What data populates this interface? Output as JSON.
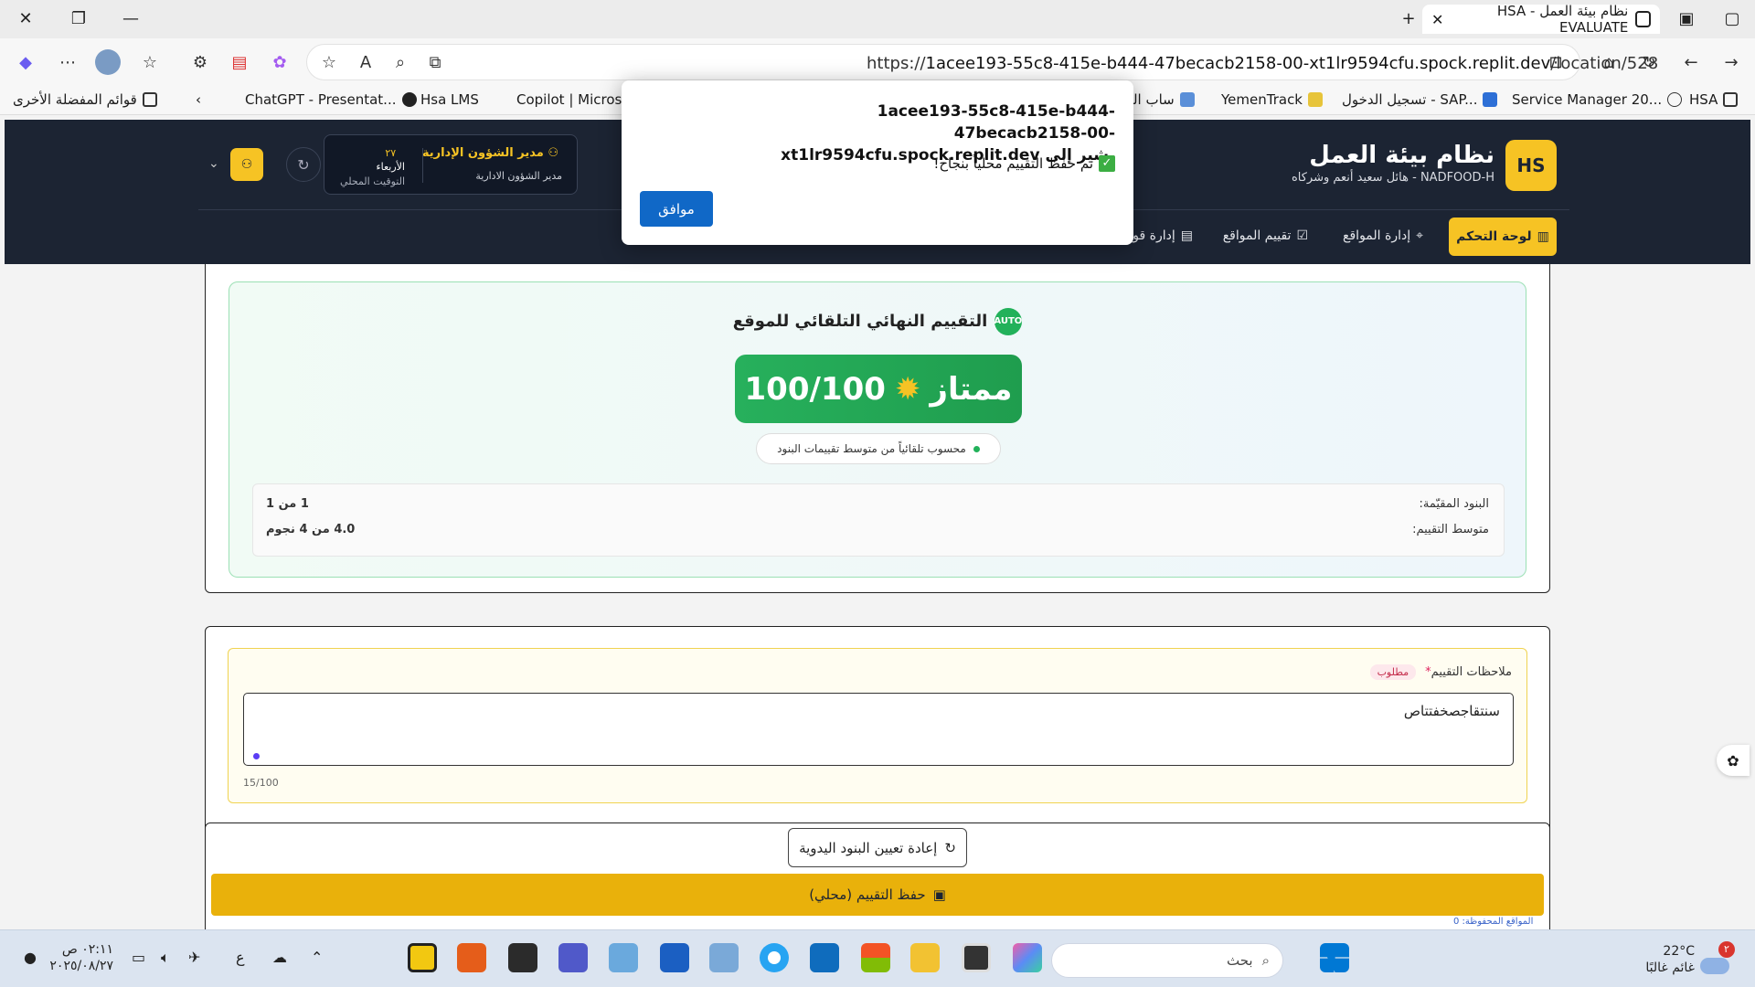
{
  "browser": {
    "tab_title": "نظام بيئة العمل - HSA EVALUATE",
    "url_prefix": "https://",
    "url_host": "1acee193-55c8-415e-b444-47becacb2158-00-xt1lr9594cfu.spock.replit.dev",
    "url_path": "/location/528"
  },
  "favorites": {
    "other": "قوائم المفضلة الأخرى",
    "items": [
      "ChatGPT - Presentat...",
      "Hsa LMS",
      "Copilot | Microsof",
      "ساب الم",
      "YemenTrack",
      "تسجيل الدخول - SAP...",
      "Service Manager 20...",
      "HSA"
    ]
  },
  "app": {
    "logo": "HS",
    "title": "نظام بيئة العمل",
    "subtitle": "NADFOOD-H - هائل سعيد أنعم وشركاه",
    "user_name": "مدير الشؤون الإدارية",
    "user_role": "مدير الشؤون الادارية",
    "day_num": "٢٧",
    "day_name": "الأربعاء",
    "timezone": "التوقيت المحلي",
    "nav": [
      "لوحة التحكم",
      "إدارة المواقع",
      "تقييم المواقع",
      "إدارة قوائم"
    ]
  },
  "dialog": {
    "host_line1": "1acee193-55c8-415e-b444-47becacb2158-00-",
    "host_line2": "xt1lr9594cfu.spock.replit.dev يشير إلى",
    "message": "تم حفظ التقييم محلياً بنجاح!",
    "ok": "موافق"
  },
  "final": {
    "badge": "AUTO",
    "title": "التقييم النهائي التلقائي للموقع",
    "score": "100/100",
    "grade": "ممتاز",
    "pill": "محسوب تلقائياً من متوسط تقييمات البنود",
    "stats": [
      {
        "label": "البنود المقيّمة:",
        "value": "1 من 1"
      },
      {
        "label": "متوسط التقييم:",
        "value": "4.0 من 4 نجوم"
      }
    ]
  },
  "notes": {
    "label": "ملاحظات التقييم",
    "asterisk": "*",
    "required": "مطلوب",
    "value": "سنتقاجصخفتتاص",
    "counter": "15/100"
  },
  "actions": {
    "reset": "إعادة تعيين البنود اليدوية",
    "save": "حفظ التقييم (محلي)",
    "footnote": "المواقع المحفوظة: 0"
  },
  "taskbar": {
    "temp": "22°C",
    "weather": "غائم غالبًا",
    "search": "بحث",
    "time": "٠٢:١١ ص",
    "date": "٢٠٢٥/٠٨/٢٧",
    "notif_count": "٢",
    "lang": "ع"
  },
  "colors": {
    "brand_yellow": "#f6c324",
    "header_bg": "#1c2433",
    "score_green": "#22b15a",
    "save_button": "#e9b10b",
    "ok_button": "#1068c7"
  }
}
